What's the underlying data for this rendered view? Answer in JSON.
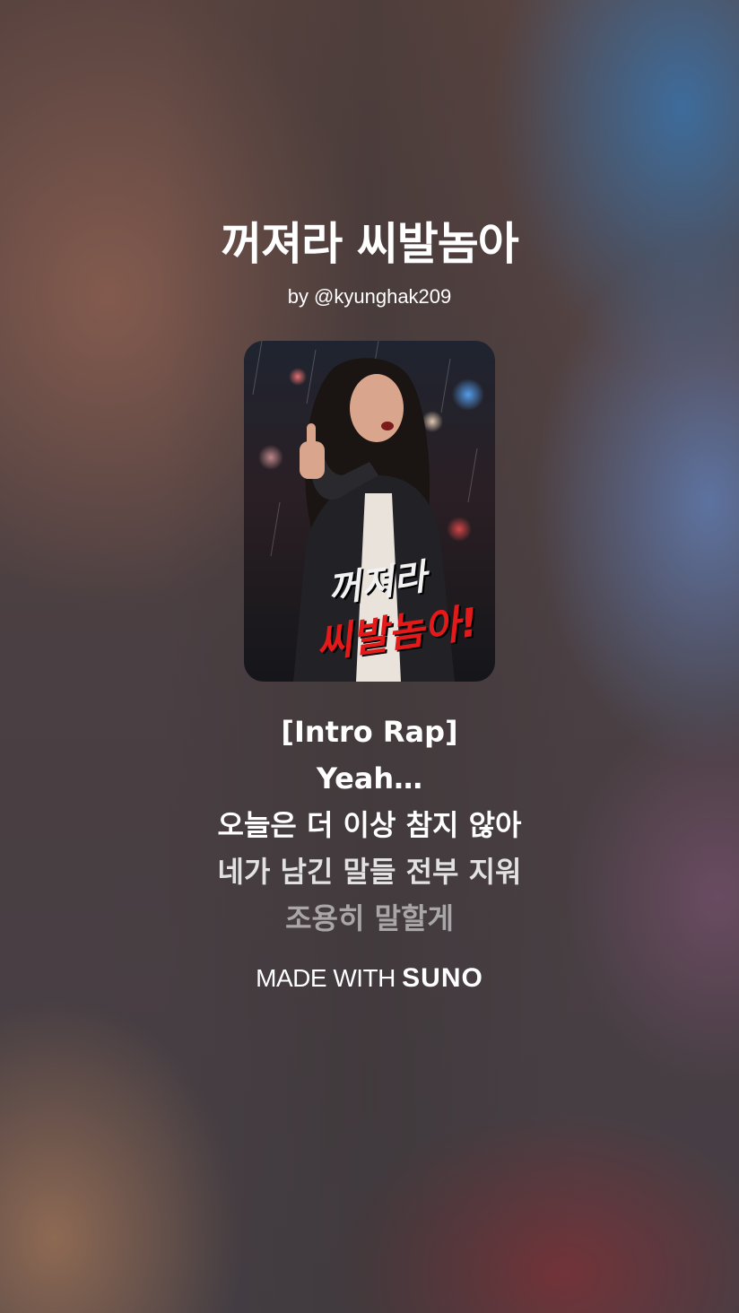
{
  "song": {
    "title": "꺼져라 씨발놈아",
    "artist": "by @kyunghak209",
    "cover_text_line1": "꺼져라",
    "cover_text_line2": "씨발놈아!"
  },
  "lyrics": [
    "[Intro Rap]",
    "Yeah…",
    "오늘은 더 이상 참지 않아",
    "네가 남긴 말들 전부 지워",
    "조용히 말할게"
  ],
  "branding": {
    "made_with": "MADE WITH",
    "brand": "SUNO"
  }
}
